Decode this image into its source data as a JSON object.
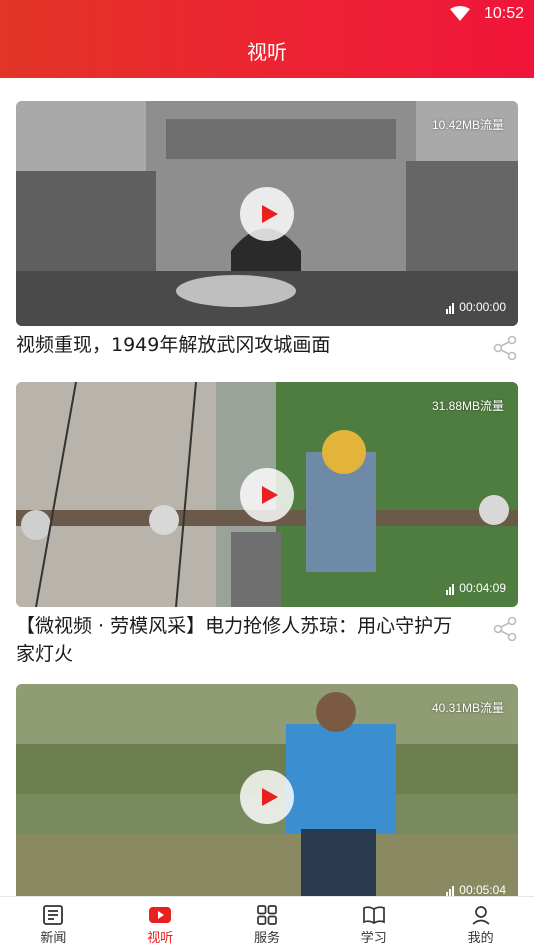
{
  "status": {
    "time": "10:52"
  },
  "header": {
    "title": "视听"
  },
  "videos": [
    {
      "title": "视频重现，1949年解放武冈攻城画面",
      "size": "10.42MB流量",
      "duration": "00:00:00"
    },
    {
      "title": "【微视频 · 劳模风采】电力抢修人苏琼：用心守护万家灯火",
      "size": "31.88MB流量",
      "duration": "00:04:09"
    },
    {
      "title": "",
      "size": "40.31MB流量",
      "duration": "00:05:04"
    }
  ],
  "tabs": [
    {
      "label": "新闻",
      "icon": "news-icon"
    },
    {
      "label": "视听",
      "icon": "video-play-icon"
    },
    {
      "label": "服务",
      "icon": "grid-icon"
    },
    {
      "label": "学习",
      "icon": "book-icon"
    },
    {
      "label": "我的",
      "icon": "profile-icon"
    }
  ],
  "colors": {
    "accent": "#e8201f",
    "header_start": "#e23427",
    "header_end": "#f0153a"
  }
}
